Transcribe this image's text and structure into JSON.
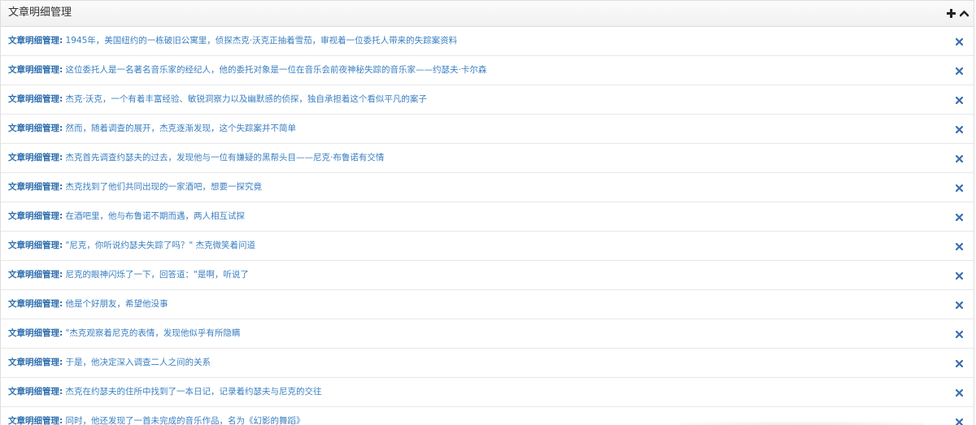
{
  "panel": {
    "title": "文章明细管理",
    "add_icon": "plus-icon",
    "collapse_icon": "chevron-up-icon"
  },
  "colors": {
    "link": "#3a7fc1",
    "label": "#2f6fae",
    "close": "#3a6fb0",
    "header_bg": "#f5f5f5",
    "border": "#dddddd"
  },
  "rows": [
    {
      "label": "文章明细管理:",
      "text": " 1945年，美国纽约的一栋破旧公寓里，侦探杰克·沃克正抽着雪茄，审视着一位委托人带来的失踪案资料",
      "close_icon": "close-icon"
    },
    {
      "label": "文章明细管理:",
      "text": " 这位委托人是一名著名音乐家的经纪人，他的委托对象是一位在音乐会前夜神秘失踪的音乐家——约瑟夫·卡尔森",
      "close_icon": "close-icon"
    },
    {
      "label": "文章明细管理:",
      "text": " 杰克·沃克，一个有着丰富经验、敏锐洞察力以及幽默感的侦探，独自承担着这个看似平凡的案子",
      "close_icon": "close-icon"
    },
    {
      "label": "文章明细管理:",
      "text": " 然而，随着调查的展开，杰克逐渐发现，这个失踪案并不简单",
      "close_icon": "close-icon"
    },
    {
      "label": "文章明细管理:",
      "text": " 杰克首先调查约瑟夫的过去，发现他与一位有嫌疑的黑帮头目——尼克·布鲁诺有交情",
      "close_icon": "close-icon"
    },
    {
      "label": "文章明细管理:",
      "text": " 杰克找到了他们共同出现的一家酒吧，想要一探究竟",
      "close_icon": "close-icon"
    },
    {
      "label": "文章明细管理:",
      "text": " 在酒吧里，他与布鲁诺不期而遇，两人相互试探",
      "close_icon": "close-icon"
    },
    {
      "label": "文章明细管理:",
      "text": " \"尼克，你听说约瑟夫失踪了吗？\" 杰克微笑着问道",
      "close_icon": "close-icon"
    },
    {
      "label": "文章明细管理:",
      "text": " 尼克的眼神闪烁了一下，回答道：\"是啊，听说了",
      "close_icon": "close-icon"
    },
    {
      "label": "文章明细管理:",
      "text": " 他是个好朋友，希望他没事",
      "close_icon": "close-icon"
    },
    {
      "label": "文章明细管理:",
      "text": " \"杰克观察着尼克的表情，发现他似乎有所隐瞒",
      "close_icon": "close-icon"
    },
    {
      "label": "文章明细管理:",
      "text": " 于是，他决定深入调查二人之间的关系",
      "close_icon": "close-icon"
    },
    {
      "label": "文章明细管理:",
      "text": " 杰克在约瑟夫的住所中找到了一本日记，记录着约瑟夫与尼克的交往",
      "close_icon": "close-icon"
    },
    {
      "label": "文章明细管理:",
      "text": " 同时，他还发现了一首未完成的音乐作品，名为《幻影的舞蹈》",
      "close_icon": "close-icon"
    }
  ]
}
